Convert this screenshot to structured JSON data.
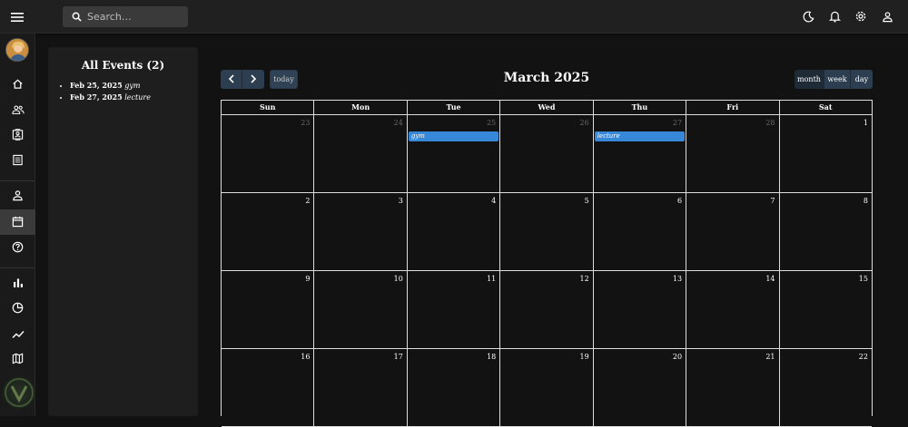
{
  "search": {
    "placeholder": "Search…"
  },
  "header_icons": [
    "moon-icon",
    "bell-icon",
    "gear-icon",
    "user-icon"
  ],
  "sidebar": {
    "items": [
      {
        "name": "home-icon"
      },
      {
        "name": "team-icon"
      },
      {
        "name": "contacts-icon"
      },
      {
        "name": "invoices-icon"
      },
      {
        "name": "profile-icon"
      },
      {
        "name": "calendar-icon",
        "active": true
      },
      {
        "name": "help-icon"
      },
      {
        "name": "bar-chart-icon"
      },
      {
        "name": "pie-chart-icon"
      },
      {
        "name": "line-chart-icon"
      },
      {
        "name": "map-icon"
      }
    ]
  },
  "events_panel": {
    "title": "All Events (2)",
    "events": [
      {
        "date": "Feb 25, 2025",
        "title": "gym"
      },
      {
        "date": "Feb 27, 2025",
        "title": "lecture"
      }
    ]
  },
  "calendar": {
    "title": "March 2025",
    "today_label": "today",
    "views": {
      "month": "month",
      "week": "week",
      "day": "day"
    },
    "weekdays": [
      "Sun",
      "Mon",
      "Tue",
      "Wed",
      "Thu",
      "Fri",
      "Sat"
    ],
    "weeks": [
      [
        {
          "num": "23",
          "other": true
        },
        {
          "num": "24",
          "other": true
        },
        {
          "num": "25",
          "other": true,
          "event": "gym"
        },
        {
          "num": "26",
          "other": true
        },
        {
          "num": "27",
          "other": true,
          "event": "lecture"
        },
        {
          "num": "28",
          "other": true
        },
        {
          "num": "1"
        }
      ],
      [
        {
          "num": "2"
        },
        {
          "num": "3"
        },
        {
          "num": "4"
        },
        {
          "num": "5"
        },
        {
          "num": "6"
        },
        {
          "num": "7"
        },
        {
          "num": "8"
        }
      ],
      [
        {
          "num": "9"
        },
        {
          "num": "10"
        },
        {
          "num": "11"
        },
        {
          "num": "12"
        },
        {
          "num": "13"
        },
        {
          "num": "14"
        },
        {
          "num": "15"
        }
      ],
      [
        {
          "num": "16"
        },
        {
          "num": "17"
        },
        {
          "num": "18"
        },
        {
          "num": "19"
        },
        {
          "num": "20"
        },
        {
          "num": "21"
        },
        {
          "num": "22"
        }
      ]
    ]
  },
  "colors": {
    "event": "#3788d8",
    "button": "#2c3e50",
    "background": "#121212"
  }
}
